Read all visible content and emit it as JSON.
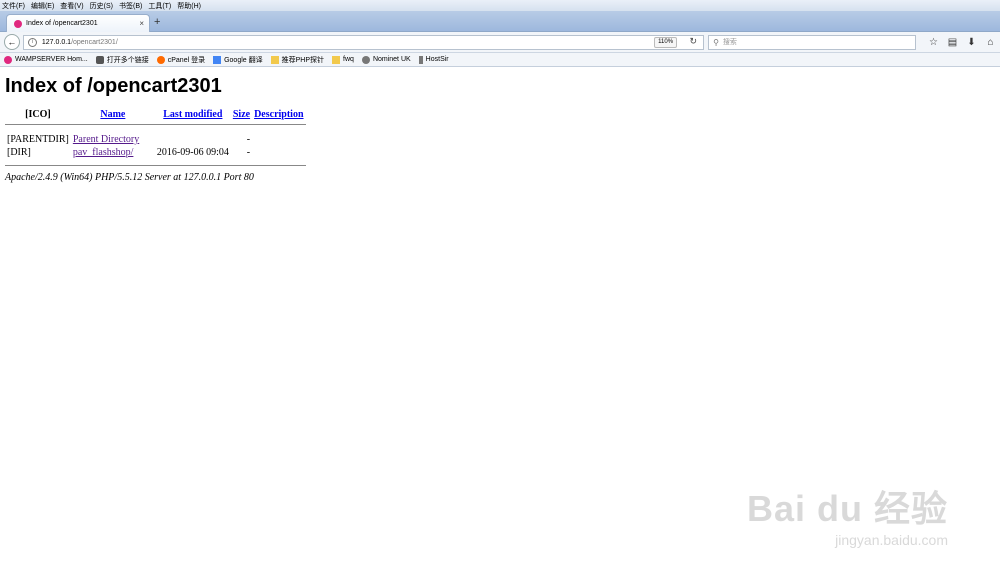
{
  "menu": [
    "文件(F)",
    "编辑(E)",
    "查看(V)",
    "历史(S)",
    "书签(B)",
    "工具(T)",
    "帮助(H)"
  ],
  "tab": {
    "title": "Index of /opencart2301",
    "close": "×"
  },
  "newtab": "+",
  "urlbar": {
    "host": "127.0.0.1",
    "path": "/opencart2301/",
    "zoom": "110%"
  },
  "search": {
    "placeholder": "搜索"
  },
  "bookmarks": [
    {
      "label": "WAMPSERVER Hom...",
      "color": "#e0287f"
    },
    {
      "label": "打开多个链接",
      "color": "#555555"
    },
    {
      "label": "cPanel 登录",
      "color": "#ff6a00"
    },
    {
      "label": "Google 翻译",
      "color": "#4285f4"
    },
    {
      "label": "推荐PHP探针",
      "color": "#f2c94c"
    },
    {
      "label": "fwq",
      "color": "#f2c94c"
    },
    {
      "label": "Nominet UK",
      "color": "#777777"
    },
    {
      "label": "HostSir",
      "color": "#777777"
    }
  ],
  "page": {
    "title": "Index of /opencart2301",
    "headers": {
      "ico": "[ICO]",
      "name": "Name",
      "modified": "Last modified",
      "size": "Size",
      "description": "Description"
    },
    "rows": [
      {
        "icon": "[PARENTDIR]",
        "name": "Parent Directory",
        "modified": "",
        "size": "-"
      },
      {
        "icon": "[DIR]",
        "name": "pav_flashshop/",
        "modified": "2016-09-06 09:04",
        "size": "-"
      }
    ],
    "address": "Apache/2.4.9 (Win64) PHP/5.5.12 Server at 127.0.0.1 Port 80"
  },
  "watermark": {
    "brand": "Bai du 经验",
    "sub": "jingyan.baidu.com"
  }
}
